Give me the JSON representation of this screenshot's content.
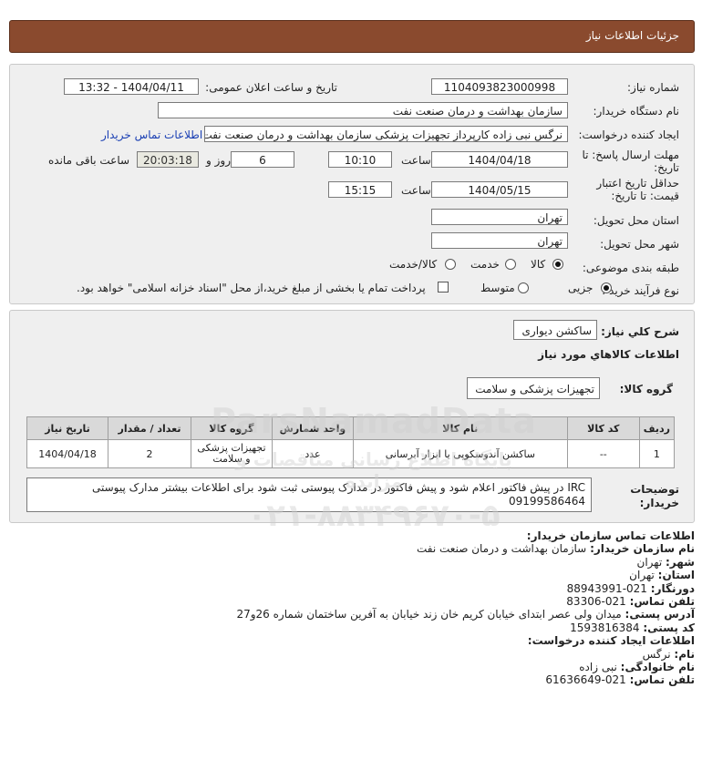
{
  "header": {
    "title": "جزئیات اطلاعات نیاز"
  },
  "form": {
    "need_number_label": "شماره نیاز:",
    "need_number": "1104093823000998",
    "announce_label": "تاریخ و ساعت اعلان عمومی:",
    "announce_value": "1404/04/11 - 13:32",
    "buyer_org_label": "نام دستگاه خریدار:",
    "buyer_org": "سازمان بهداشت و درمان صنعت نفت",
    "creator_label": "ایجاد کننده درخواست:",
    "creator": "نرگس نبی زاده کارپرداز تجهیزات پزشکی سازمان بهداشت و درمان صنعت نفت",
    "contact_link": "اطلاعات تماس خریدار",
    "deadline_label": "مهلت ارسال پاسخ: تا تاریخ:",
    "deadline_date": "1404/04/18",
    "time_label": "ساعت",
    "deadline_time": "10:10",
    "days_value": "6",
    "days_label": "روز و",
    "remaining_time": "20:03:18",
    "remaining_label": "ساعت باقی مانده",
    "validity_label": "حداقل تاریخ اعتبار قیمت: تا تاریخ:",
    "validity_date": "1404/05/15",
    "validity_time": "15:15",
    "province_label": "استان محل تحویل:",
    "province": "تهران",
    "city_label": "شهر محل تحویل:",
    "city": "تهران",
    "category_label": "طبقه بندی موضوعی:",
    "category_options": [
      "کالا",
      "خدمت",
      "کالا/خدمت"
    ],
    "process_label": "نوع فرآیند خرید :",
    "process_options": [
      "جزیی",
      "متوسط"
    ],
    "treasury_text": "پرداخت تمام یا بخشی از مبلغ خرید،از محل \"اسناد خزانه اسلامی\" خواهد بود."
  },
  "need": {
    "summary_label": "شرح كلي نياز:",
    "summary": "ساکشن دیواری",
    "goods_title": "اطلاعات كالاهاي مورد نياز",
    "group_label": "گروه کالا:",
    "group_value": "تجهیزات پزشکی و سلامت",
    "table": {
      "headers": [
        "ردیف",
        "کد کالا",
        "نام کالا",
        "واحد شمارش",
        "گروه کالا",
        "تعداد / مقدار",
        "تاریخ نیاز"
      ],
      "rows": [
        [
          "1",
          "--",
          "ساکشن آندوسکوپی یا ابزار آبرسانی",
          "عدد",
          "تجهیزات پزشکی و سلامت",
          "2",
          "1404/04/18"
        ]
      ]
    },
    "desc_label": "توضیحات خریدار:",
    "desc_text": "IRC در پیش فاکتور اعلام شود و پیش فاکتور در مدارک پیوستی ثبت شود برای اطلاعات بیشتر مدارک پیوستی 09199586464"
  },
  "contact": {
    "title": "اطلاعات تماس سازمان خریدار:",
    "org_label": "نام سازمان خریدار:",
    "org_value": "سازمان بهداشت و درمان صنعت نفت",
    "city_label": "شهر:",
    "city_value": "تهران",
    "province_label": "استان:",
    "province_value": "تهران",
    "fax_label": "دورنگار:",
    "fax_value": "021-88943991",
    "phone_label": "تلفن تماس:",
    "phone_value": "021-83306",
    "address_label": "آدرس پستی:",
    "address_value": "میدان ولی عصر ابتدای خیابان کریم خان زند خیابان به آفرین ساختمان شماره 26و27",
    "postal_label": "کد پستی:",
    "postal_value": "1593816384",
    "creator_title": "اطلاعات ایجاد کننده درخواست:",
    "name_label": "نام:",
    "name_value": "نرگس",
    "family_label": "نام خانوادگی:",
    "family_value": "نبی زاده",
    "creator_phone_label": "تلفن تماس:",
    "creator_phone_value": "021-61636649"
  },
  "watermark": {
    "text1": "ParsNamadData",
    "text2": "پایگاه اطلاع رسانی مناقصات و مزایده",
    "text3": "۰۲۱-۸۸۳۴۹۶۷۰-۵"
  }
}
